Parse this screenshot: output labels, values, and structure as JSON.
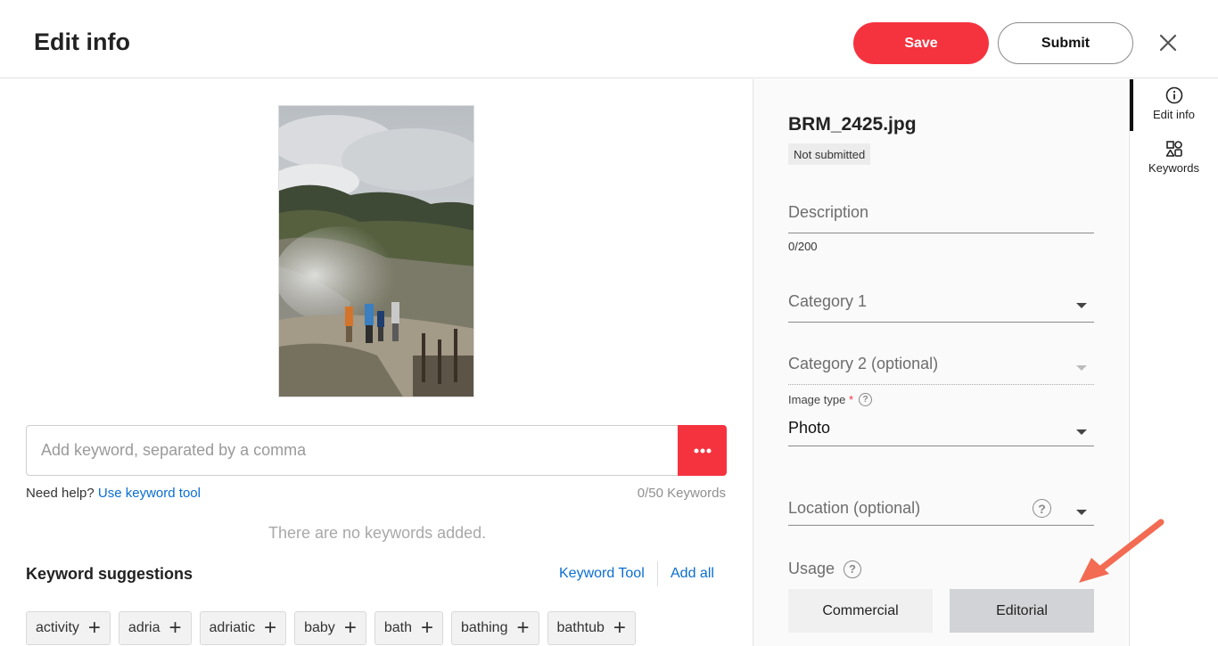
{
  "header": {
    "title": "Edit info",
    "save_label": "Save",
    "submit_label": "Submit"
  },
  "keywords": {
    "input_placeholder": "Add keyword, separated by a comma",
    "help_prefix": "Need help?",
    "help_link": "Use keyword tool",
    "count": "0/50 Keywords",
    "empty_message": "There are no keywords added."
  },
  "suggestions": {
    "title": "Keyword suggestions",
    "tool_link": "Keyword Tool",
    "add_all": "Add all",
    "chips": [
      "activity",
      "adria",
      "adriatic",
      "baby",
      "bath",
      "bathing",
      "bathtub"
    ]
  },
  "details": {
    "filename": "BRM_2425.jpg",
    "status": "Not submitted",
    "description_placeholder": "Description",
    "description_count": "0/200",
    "category1": "Category 1",
    "category2": "Category 2 (optional)",
    "image_type_label": "Image type",
    "image_type_required": "*",
    "image_type_value": "Photo",
    "location": "Location (optional)",
    "usage_label": "Usage",
    "usage_commercial": "Commercial",
    "usage_editorial": "Editorial",
    "usage_selected": "Editorial"
  },
  "rail": {
    "items": [
      {
        "label": "Edit info",
        "icon": "info-icon",
        "active": true
      },
      {
        "label": "Keywords",
        "icon": "shapes-icon",
        "active": false
      }
    ]
  },
  "colors": {
    "accent": "#f5333f",
    "link": "#0a6ed1",
    "annotation_arrow": "#f26b52"
  }
}
